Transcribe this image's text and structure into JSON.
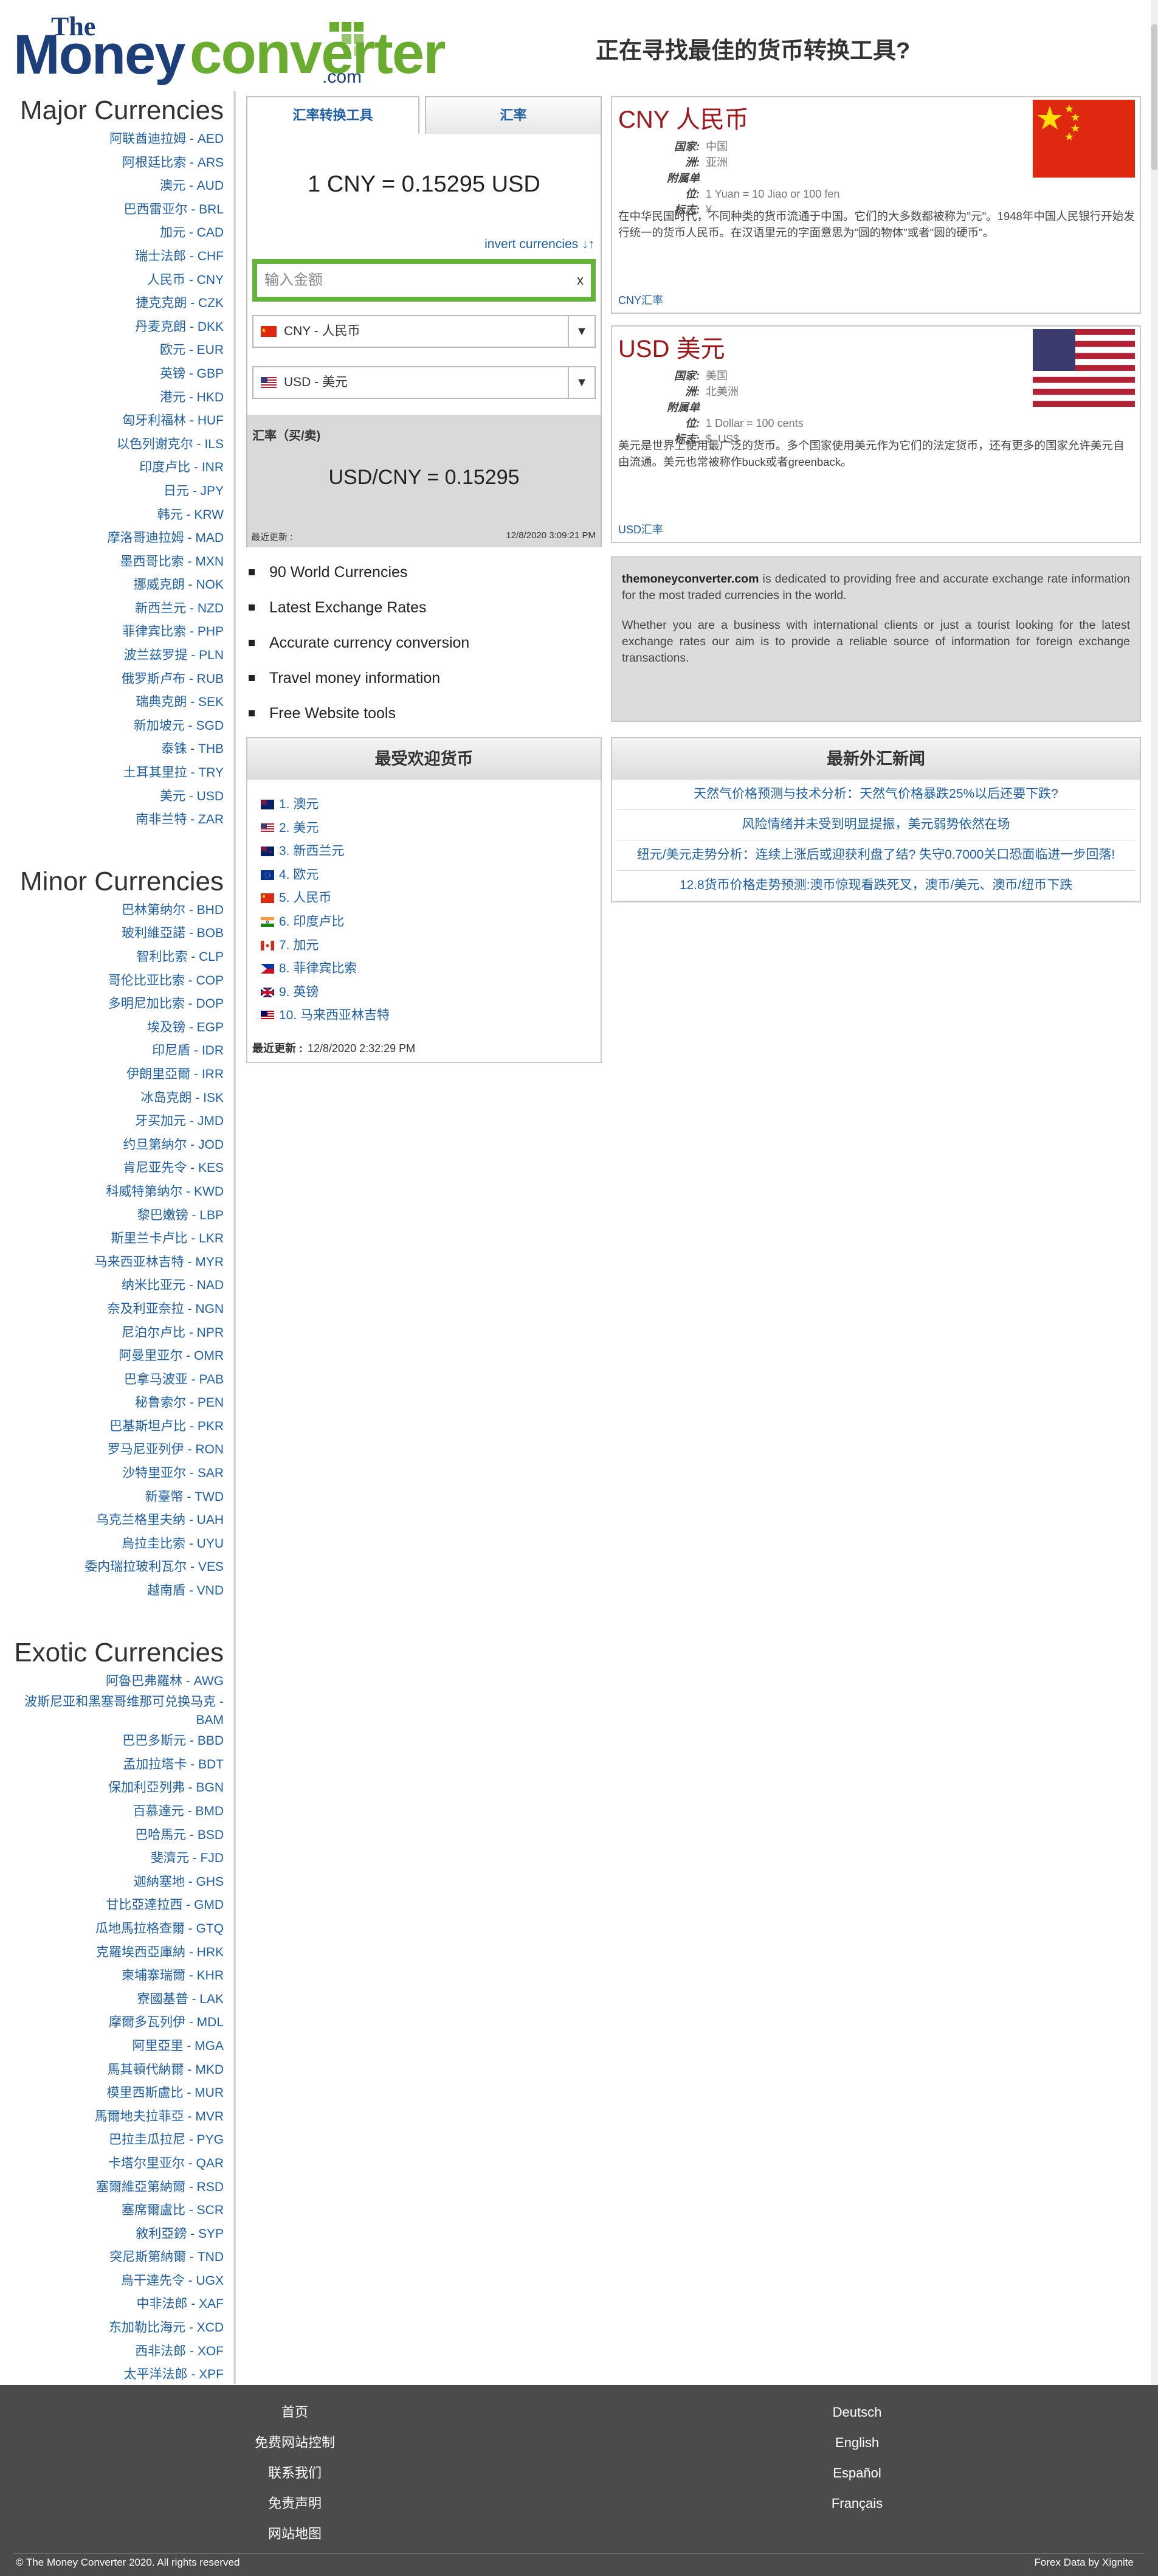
{
  "header": {
    "logo_the": "The",
    "logo_money": "Money",
    "logo_converter": "converter",
    "logo_com": ".com",
    "tagline": "正在寻找最佳的货币转换工具?"
  },
  "sidebar": {
    "major_title": "Major Currencies",
    "major": [
      "阿联酋迪拉姆 - AED",
      "阿根廷比索 - ARS",
      "澳元 - AUD",
      "巴西雷亚尔 - BRL",
      "加元 - CAD",
      "瑞士法郎 - CHF",
      "人民币 - CNY",
      "捷克克朗 - CZK",
      "丹麦克朗 - DKK",
      "欧元 - EUR",
      "英镑 - GBP",
      "港元 - HKD",
      "匈牙利福林 - HUF",
      "以色列谢克尔 - ILS",
      "印度卢比 - INR",
      "日元 - JPY",
      "韩元 - KRW",
      "摩洛哥迪拉姆 - MAD",
      "墨西哥比索 - MXN",
      "挪威克朗 - NOK",
      "新西兰元 - NZD",
      "菲律宾比索 - PHP",
      "波兰兹罗提 - PLN",
      "俄罗斯卢布 - RUB",
      "瑞典克朗 - SEK",
      "新加坡元 - SGD",
      "泰铢 - THB",
      "土耳其里拉 - TRY",
      "美元 - USD",
      "南非兰特 - ZAR"
    ],
    "minor_title": "Minor Currencies",
    "minor": [
      "巴林第纳尔 - BHD",
      "玻利維亞諾 - BOB",
      "智利比索 - CLP",
      "哥伦比亚比索 - COP",
      "多明尼加比索 - DOP",
      "埃及镑 - EGP",
      "印尼盾 - IDR",
      "伊朗里亞爾 - IRR",
      "冰岛克朗 - ISK",
      "牙买加元 - JMD",
      "约旦第纳尔 - JOD",
      "肯尼亚先令 - KES",
      "科威特第纳尔 - KWD",
      "黎巴嫩镑 - LBP",
      "斯里兰卡卢比 - LKR",
      "马来西亚林吉特 - MYR",
      "纳米比亚元 - NAD",
      "奈及利亚奈拉 - NGN",
      "尼泊尔卢比 - NPR",
      "阿曼里亚尔 - OMR",
      "巴拿马波亚 - PAB",
      "秘鲁索尔 - PEN",
      "巴基斯坦卢比 - PKR",
      "罗马尼亚列伊 - RON",
      "沙特里亚尔 - SAR",
      "新臺幣 - TWD",
      "乌克兰格里夫纳 - UAH",
      "烏拉圭比索 - UYU",
      "委内瑞拉玻利瓦尔 - VES",
      "越南盾 - VND"
    ],
    "exotic_title": "Exotic Currencies",
    "exotic": [
      "阿魯巴弗羅林 - AWG",
      "波斯尼亚和黑塞哥维那可兑换马克 - BAM",
      "巴巴多斯元 - BBD",
      "孟加拉塔卡 - BDT",
      "保加利亞列弗 - BGN",
      "百慕達元 - BMD",
      "巴哈馬元 - BSD",
      "斐濟元 - FJD",
      "迦納塞地 - GHS",
      "甘比亞達拉西 - GMD",
      "瓜地馬拉格查爾 - GTQ",
      "克羅埃西亞庫納 - HRK",
      "柬埔寨瑞爾 - KHR",
      "寮國基普 - LAK",
      "摩爾多瓦列伊 - MDL",
      "阿里亞里 - MGA",
      "馬其頓代納爾 - MKD",
      "模里西斯盧比 - MUR",
      "馬爾地夫拉菲亞 - MVR",
      "巴拉圭瓜拉尼 - PYG",
      "卡塔尔里亚尔 - QAR",
      "塞爾維亞第納爾 - RSD",
      "塞席爾盧比 - SCR",
      "敘利亞鎊 - SYP",
      "突尼斯第納爾 - TND",
      "烏干達先令 - UGX",
      "中非法郎 - XAF",
      "东加勒比海元 - XCD",
      "西非法郎 - XOF",
      "太平洋法郎 - XPF"
    ]
  },
  "converter": {
    "tab_converter": "汇率转换工具",
    "tab_rates": "汇率",
    "rate_line": "1 CNY = 0.15295 USD",
    "invert_label": "invert currencies ↓↑",
    "amount_placeholder": "输入金额",
    "clear_label": "x",
    "from_currency": "CNY - 人民币",
    "to_currency": "USD - 美元",
    "arrow": "▼",
    "buysell_label": "汇率（买/卖)",
    "buysell_value": "USD/CNY = 0.15295",
    "last_update_label": "最近更新 :",
    "last_update_time": "12/8/2020 3:09:21 PM"
  },
  "features": [
    "90 World Currencies",
    "Latest Exchange Rates",
    "Accurate currency conversion",
    "Travel money information",
    "Free Website tools"
  ],
  "cny_card": {
    "title": "CNY 人民币",
    "country_k": "国家:",
    "country_v": "中国",
    "continent_k": "洲:",
    "continent_v": "亚洲",
    "sub_k": "附属单位:",
    "sub_v": "1 Yuan = 10 Jiao or 100 fen",
    "symbol_k": "标志:",
    "symbol_v": "¥",
    "desc": "在中华民国时代，不同种类的货币流通于中国。它们的大多数都被称为\"元\"。1948年中国人民银行开始发行统一的货币人民币。在汉语里元的字面意思为\"圆的物体\"或者\"圆的硬币\"。",
    "link": "CNY汇率"
  },
  "usd_card": {
    "title": "USD 美元",
    "country_k": "国家:",
    "country_v": "美国",
    "continent_k": "洲:",
    "continent_v": "北美洲",
    "sub_k": "附属单位:",
    "sub_v": "1 Dollar = 100 cents",
    "symbol_k": "标志:",
    "symbol_v": "$, US$",
    "desc": "美元是世界上使用最广泛的货币。多个国家使用美元作为它们的法定货币，还有更多的国家允许美元自由流通。美元也常被称作buck或者greenback。",
    "link": "USD汇率"
  },
  "about": {
    "site": "themoneyconverter.com",
    "p1_rest": " is dedicated to providing free and accurate exchange rate information for the most traded currencies in the world.",
    "p2": "Whether you are a business with international clients or just a tourist looking for the latest exchange rates our aim is to provide a reliable source of information for foreign exchange transactions."
  },
  "popular": {
    "title": "最受欢迎货币",
    "items": [
      "1. 澳元",
      "2. 美元",
      "3. 新西兰元",
      "4. 欧元",
      "5. 人民币",
      "6. 印度卢比",
      "7. 加元",
      "8. 菲律宾比索",
      "9. 英镑",
      "10. 马来西亚林吉特"
    ],
    "update_label": "最近更新 :",
    "update_time": "12/8/2020 2:32:29 PM"
  },
  "news": {
    "title": "最新外汇新闻",
    "items": [
      "天然气价格预测与技术分析：天然气价格暴跌25%以后还要下跌?",
      "风险情绪并未受到明显提振，美元弱势依然在场",
      "纽元/美元走势分析：连续上涨后或迎获利盘了结? 失守0.7000关口恐面临进一步回落!",
      "12.8货币价格走势预测:澳币惊现看跌死叉，澳币/美元、澳币/纽币下跌"
    ]
  },
  "footer": {
    "left": [
      "首页",
      "免费网站控制",
      "联系我们",
      "免责声明",
      "网站地图"
    ],
    "right": [
      "Deutsch",
      "English",
      "Español",
      "Français"
    ],
    "copyright": "© The Money Converter 2020. All rights reserved",
    "forex": "Forex Data by Xignite"
  },
  "colors": {
    "brand_blue": "#1c3f7a",
    "brand_green": "#6aac2f",
    "link": "#1f5fa8",
    "card_title": "#a0161b",
    "footer_bg": "#4b4b4b"
  }
}
